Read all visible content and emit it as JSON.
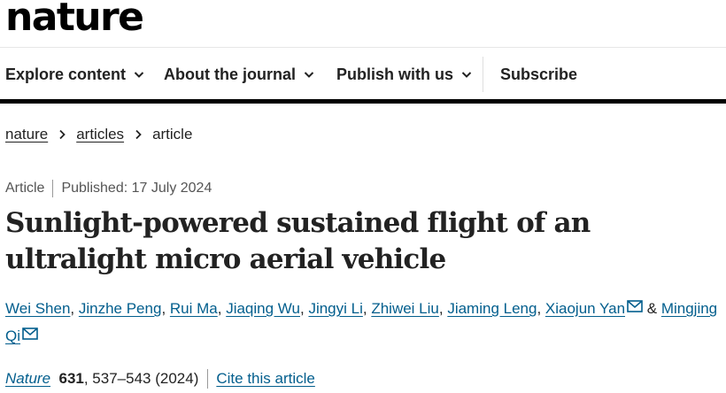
{
  "site": {
    "logo": "nature"
  },
  "nav": {
    "items": [
      {
        "label": "Explore content"
      },
      {
        "label": "About the journal"
      },
      {
        "label": "Publish with us"
      },
      {
        "label": "Subscribe"
      }
    ]
  },
  "breadcrumb": {
    "items": [
      "nature",
      "articles",
      "article"
    ]
  },
  "article": {
    "type": "Article",
    "published": "Published: 17 July 2024",
    "title": "Sunlight-powered sustained flight of an ultralight micro aerial vehicle",
    "authors": [
      "Wei Shen",
      "Jinzhe Peng",
      "Rui Ma",
      "Jiaqing Wu",
      "Jingyi Li",
      "Zhiwei Liu",
      "Jiaming Leng",
      "Xiaojun Yan",
      "Mingjing Qi"
    ],
    "author_separator": ", ",
    "author_last_separator": " & ",
    "citation": {
      "journal": "Nature",
      "volume": "631",
      "pages_year": ", 537–543 (2024)",
      "cite_label": "Cite this article"
    }
  },
  "colors": {
    "link": "#025e8d",
    "text": "#222222",
    "rule": "#000000"
  },
  "icons": {
    "nav_chevron": "chevron-down-icon",
    "crumb_chevron": "chevron-right-icon",
    "email": "envelope-icon"
  }
}
